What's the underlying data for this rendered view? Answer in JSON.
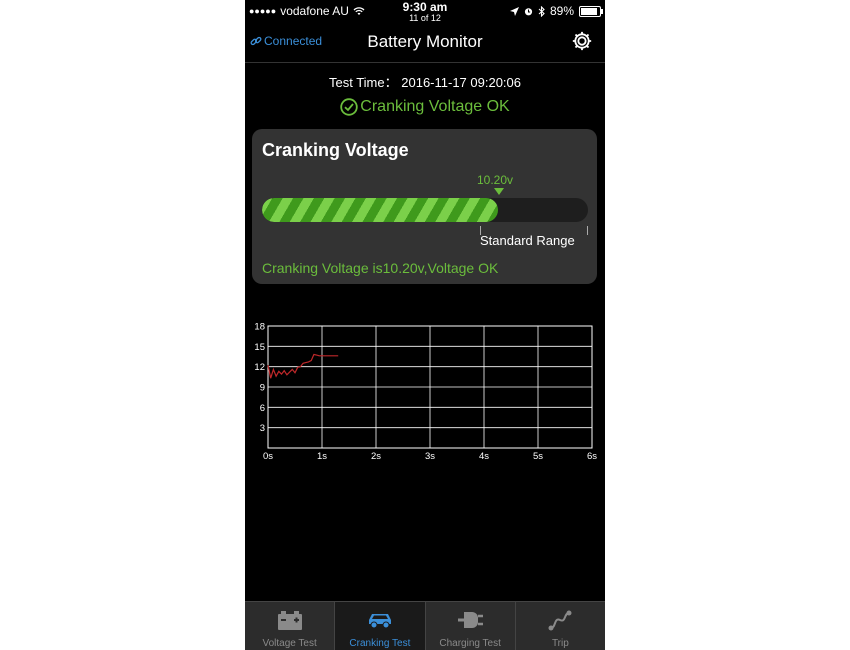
{
  "status_bar": {
    "carrier": "vodafone AU",
    "time": "9:30 am",
    "counter": "11 of 12",
    "battery_percent": "89%",
    "battery_level": 0.89
  },
  "nav": {
    "connected_label": "Connected",
    "title": "Battery Monitor",
    "settings_icon": "gear-icon"
  },
  "test": {
    "time_label": "Test Time",
    "time_separator": "：",
    "time_value": "2016-11-17 09:20:06",
    "status": "Cranking Voltage OK"
  },
  "card": {
    "title": "Cranking Voltage",
    "bar_value": "10.20v",
    "bar_fill_fraction": 0.725,
    "range_label": "Standard Range",
    "message": "Cranking Voltage is10.20v,Voltage OK"
  },
  "colors": {
    "accent_green": "#6bbd3c",
    "accent_blue": "#3b8fd9",
    "line_red": "#c0282a"
  },
  "chart_data": {
    "type": "line",
    "x_ticks": [
      "0s",
      "1s",
      "2s",
      "3s",
      "4s",
      "5s",
      "6s"
    ],
    "y_ticks": [
      "18",
      "15",
      "12",
      "9",
      "6",
      "3"
    ],
    "xlim": [
      0,
      6
    ],
    "ylim": [
      0,
      18
    ],
    "grid": true,
    "series": [
      {
        "color": "#c0282a",
        "x": [
          0,
          0.05,
          0.1,
          0.15,
          0.2,
          0.25,
          0.3,
          0.35,
          0.4,
          0.45,
          0.5,
          0.55,
          0.6,
          0.65,
          0.7,
          0.75,
          0.8,
          0.85,
          0.9,
          0.95,
          1.0,
          1.1,
          1.2,
          1.3
        ],
        "y": [
          12.2,
          10.3,
          11.6,
          10.6,
          11.3,
          10.9,
          11.4,
          10.8,
          11.2,
          11.6,
          11.1,
          11.9,
          12.0,
          12.5,
          12.6,
          12.7,
          12.9,
          13.8,
          13.7,
          13.6,
          13.6,
          13.6,
          13.6,
          13.6
        ]
      }
    ]
  },
  "tabs": [
    {
      "label": "Voltage Test",
      "icon": "battery-icon",
      "active": false
    },
    {
      "label": "Cranking Test",
      "icon": "car-icon",
      "active": true
    },
    {
      "label": "Charging Test",
      "icon": "plug-icon",
      "active": false
    },
    {
      "label": "Trip",
      "icon": "route-icon",
      "active": false
    }
  ]
}
